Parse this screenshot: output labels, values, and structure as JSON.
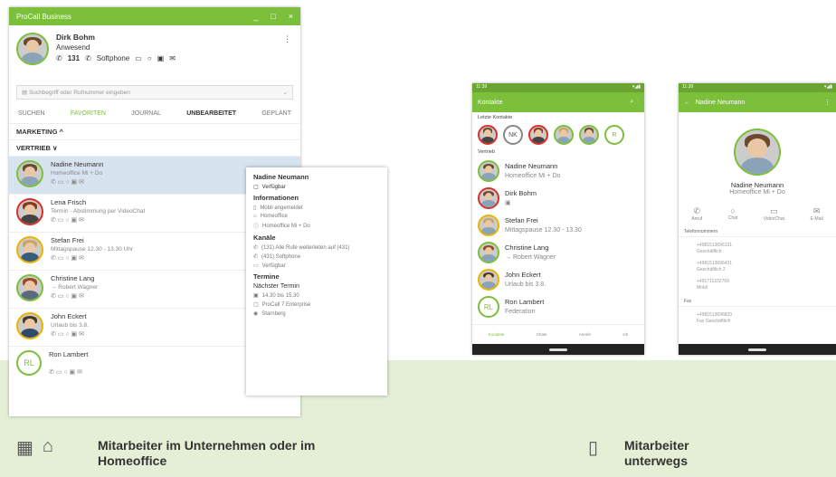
{
  "desktop": {
    "title": "ProCall Business",
    "controls": [
      "_",
      "□",
      "×"
    ],
    "me": {
      "name": "Dirk Bohm",
      "status": "Anwesend",
      "phone": "131",
      "softphone": "Softphone"
    },
    "search_placeholder": "Suchbegriff oder Rufnummer eingeben",
    "tabs": [
      "SUCHEN",
      "FAVORITEN",
      "JOURNAL",
      "UNBEARBEITET",
      "GEPLANT"
    ],
    "groups": [
      "MARKETING ^",
      "VERTRIEB ∨"
    ],
    "contacts": [
      {
        "name": "Nadine Neumann",
        "sub": "Homeoffice Mi + Do"
      },
      {
        "name": "Lena Frisch",
        "sub": "Termin - Abstimmung per VideoChat"
      },
      {
        "name": "Stefan Frei",
        "sub": "Mittagspause 12.30 - 13.30 Uhr"
      },
      {
        "name": "Christine Lang",
        "sub": "→ Robert Wagner"
      },
      {
        "name": "John Eckert",
        "sub": "Urlaub bis 3.8."
      },
      {
        "name": "Ron Lambert",
        "sub": ""
      }
    ],
    "rl": "RL"
  },
  "popup": {
    "name": "Nadine Neumann",
    "avail": "Verfügbar",
    "h_info": "Informationen",
    "info": [
      "Mobil angemeldet",
      "Homeoffice",
      "Homeoffice Mi + Do"
    ],
    "h_kanale": "Kanäle",
    "kanale": [
      "(131) Alle Rufe weiterleiten auf (431)",
      "(431) Softphone",
      "Verfügbar"
    ],
    "h_termine": "Termine",
    "next": "Nächster Termin",
    "termine": [
      "14.30 bis 15.30",
      "ProCall 7 Enterprise",
      "Starnberg"
    ]
  },
  "phone1": {
    "time": "11:39",
    "title": "Kontakte",
    "recent": "Letzte Kontakte",
    "nk": "NK",
    "r": "R",
    "group": "Vertrieb",
    "contacts": [
      {
        "name": "Nadine Neumann",
        "sub": "Homeoffice Mi + Do"
      },
      {
        "name": "Dirk Bohm",
        "sub": ""
      },
      {
        "name": "Stefan Frei",
        "sub": "Mittagspause 12.30 - 13.30"
      },
      {
        "name": "Christine Lang",
        "sub": "→ Robert Wagner"
      },
      {
        "name": "John Eckert",
        "sub": "Urlaub bis 3.8."
      },
      {
        "name": "Ron Lambert",
        "sub": "Federation"
      }
    ],
    "rl": "RL",
    "nav": [
      "Kontakte",
      "Chats",
      "Anrufe",
      "Ich"
    ]
  },
  "phone2": {
    "time": "11:39",
    "title": "Nadine Neumann",
    "name": "Nadine Neumann",
    "sub": "Homeoffice Mi + Do",
    "actions": [
      "Anruf",
      "Chat",
      "VideoChat",
      "E-Mail"
    ],
    "sec_tel": "Telefonnummern",
    "numbers": [
      {
        "num": "+4981513696131",
        "label": "Geschäftlich"
      },
      {
        "num": "+4981513696431",
        "label": "Geschäftlich 2"
      },
      {
        "num": "+491711232769",
        "label": "Mobil"
      }
    ],
    "sec_fax": "Fax",
    "fax": {
      "num": "+4981513696833",
      "label": "Fax Geschäftlich"
    }
  },
  "captions": {
    "left": "Mitarbeiter im Unternehmen oder im Homeoffice",
    "right": "Mitarbeiter unterwegs"
  },
  "colors": {
    "accent": "#7cbf3a",
    "band": "#e4efd6",
    "highlight": "#d7e3ef"
  }
}
